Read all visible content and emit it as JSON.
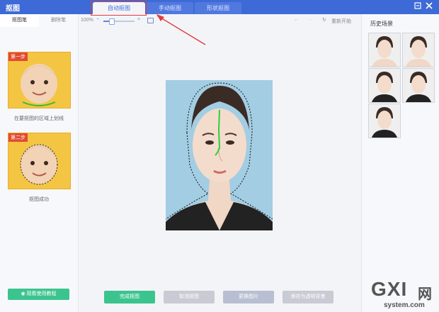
{
  "app": {
    "title": "抠图"
  },
  "tabs": [
    {
      "label": "自动抠图"
    },
    {
      "label": "手动抠图"
    },
    {
      "label": "形状抠图"
    }
  ],
  "left_panel": {
    "tabs": [
      {
        "label": "抠图笔"
      },
      {
        "label": "删除笔"
      }
    ],
    "steps": [
      {
        "label": "第一步",
        "caption": "在要抠图的区域上划线"
      },
      {
        "label": "第二步",
        "caption": "抠图成功"
      }
    ],
    "tutorial_button": "观看使用教程"
  },
  "toolbar": {
    "zoom_level": "100%",
    "zoom_fraction": 0.25,
    "restart_label": "重新开始"
  },
  "right_panel": {
    "title": "历史场景"
  },
  "bottom_buttons": [
    {
      "label": "完成抠图"
    },
    {
      "label": "取消抠图"
    },
    {
      "label": "更换图片"
    },
    {
      "label": "保存为透明背景"
    }
  ],
  "watermark": {
    "brand": "GXI",
    "brand_suffix": "网",
    "domain": "system.com"
  },
  "colors": {
    "accent": "#3d6ad6",
    "primary_green": "#3cc48f",
    "disabled_gray": "#c8cbd4",
    "highlight_red": "#e23b3b",
    "canvas_background": "#a3cde3"
  }
}
